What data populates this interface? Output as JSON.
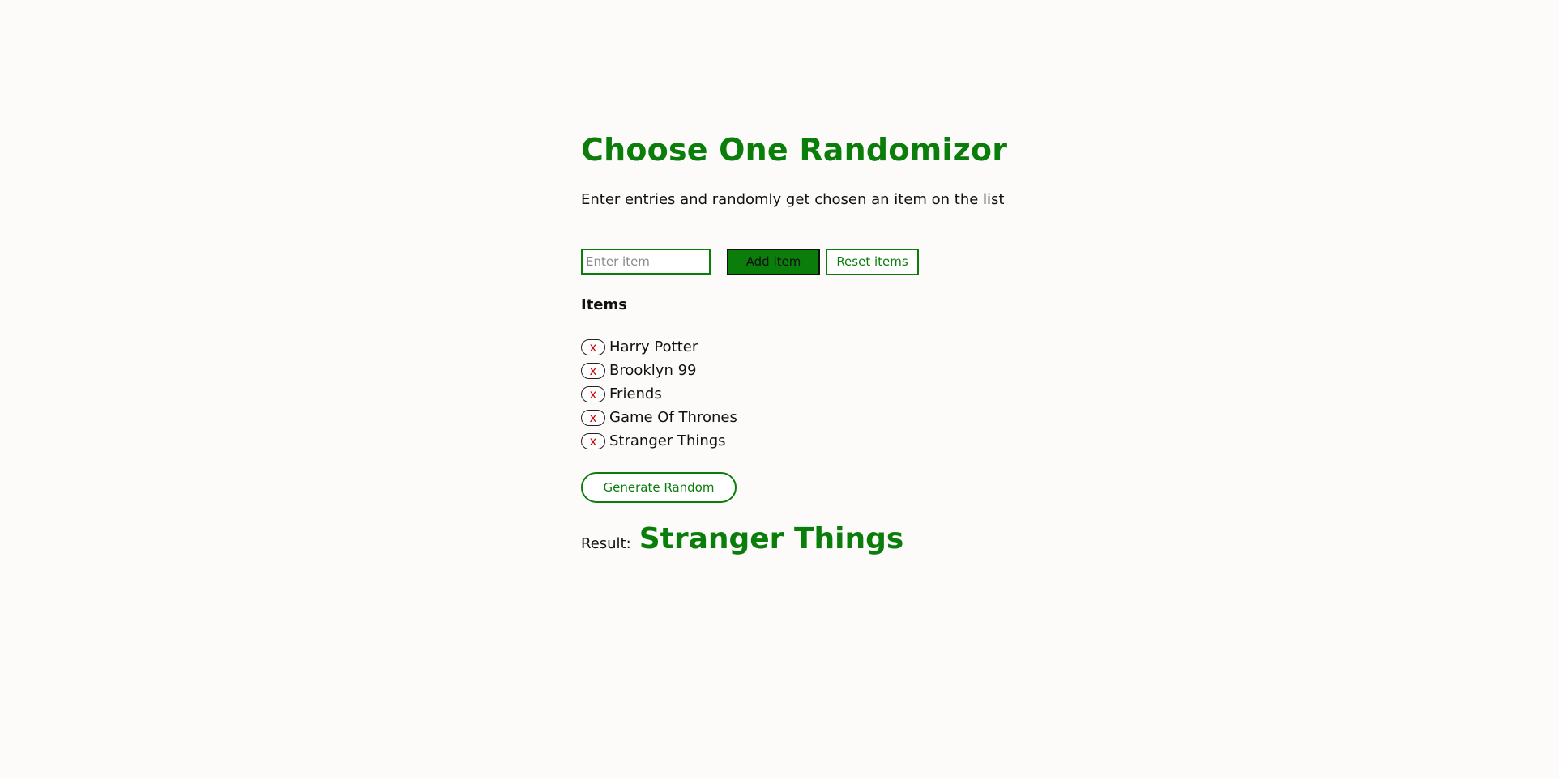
{
  "header": {
    "title": "Choose One Randomizor",
    "subtitle": "Enter entries and randomly get chosen an item on the list"
  },
  "controls": {
    "input_placeholder": "Enter item",
    "input_value": "",
    "add_label": "Add item",
    "reset_label": "Reset items"
  },
  "items_section": {
    "heading": "Items",
    "remove_label": "x",
    "items": [
      {
        "label": "Harry Potter"
      },
      {
        "label": "Brooklyn 99"
      },
      {
        "label": "Friends"
      },
      {
        "label": "Game Of Thrones"
      },
      {
        "label": "Stranger Things"
      }
    ]
  },
  "generate_label": "Generate Random",
  "result": {
    "label": "Result:",
    "value": "Stranger Things"
  },
  "colors": {
    "accent": "#0a7d0a",
    "remove": "#d40000",
    "background": "#fcfbfa"
  }
}
